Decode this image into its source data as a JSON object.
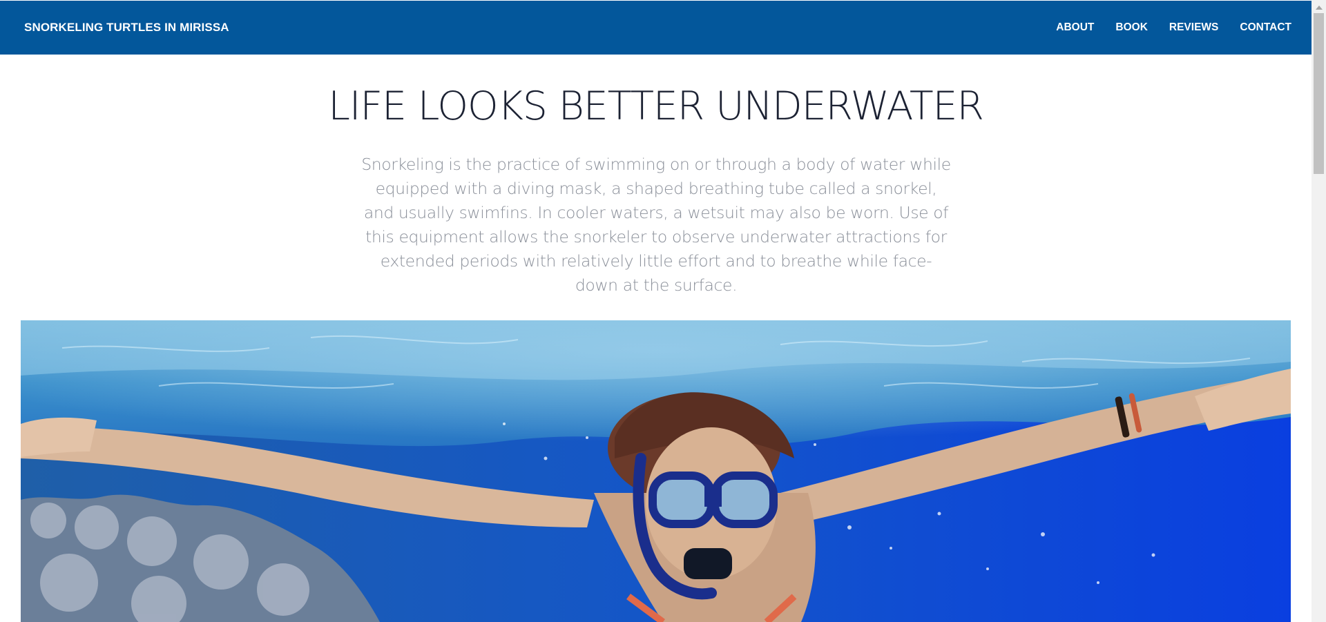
{
  "header": {
    "brand": "SNORKELING TURTLES IN MIRISSA",
    "nav": [
      "ABOUT",
      "BOOK",
      "REVIEWS",
      "CONTACT"
    ]
  },
  "hero": {
    "heading": "LIFE LOOKS BETTER UNDERWATER",
    "intro": "Snorkeling is the practice of swimming on or through a body of water while equipped with a diving mask, a shaped breathing tube called a snorkel, and usually swimfins. In cooler waters, a wetsuit may also be worn. Use of this equipment allows the snorkeler to observe underwater attractions for extended periods with relatively little effort and to breathe while face-down at the surface."
  },
  "colors": {
    "navbar": "#03579b",
    "heading": "#1c2233",
    "intro": "#8a8f99"
  }
}
